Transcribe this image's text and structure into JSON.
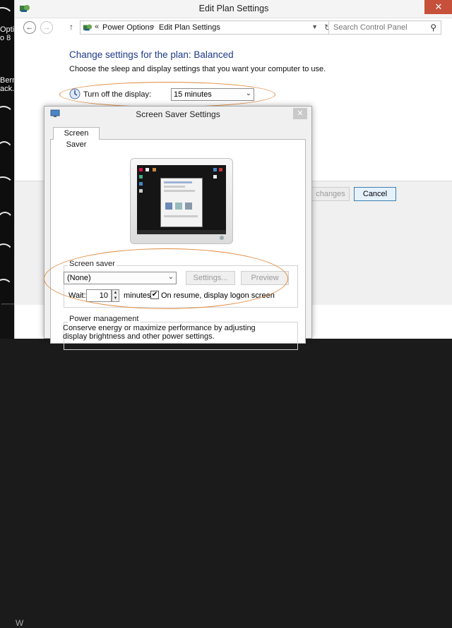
{
  "desktop": {
    "labels": [
      "Optic",
      "o 8",
      "Bern",
      "ack."
    ],
    "logo_text": "W"
  },
  "window": {
    "title": "Edit Plan Settings",
    "close_glyph": "✕"
  },
  "navigation": {
    "back_glyph": "←",
    "forward_glyph": "→",
    "up_glyph": "↑",
    "breadcrumb_sep": "«",
    "breadcrumbs": [
      "Power Options",
      "Edit Plan Settings"
    ],
    "crumb_arrow": "›",
    "search_placeholder": "Search Control Panel"
  },
  "plan": {
    "heading": "Change settings for the plan: Balanced",
    "subheading": "Choose the sleep and display settings that you want your computer to use.",
    "display_label": "Turn off the display:",
    "display_value": "15 minutes",
    "save_label": "changes",
    "cancel_label": "Cancel"
  },
  "dialog": {
    "title": "Screen Saver Settings",
    "close_glyph": "✕",
    "tab": "Screen Saver",
    "screen_saver_group": "Screen saver",
    "screen_saver_value": "(None)",
    "settings_button": "Settings...",
    "preview_button": "Preview",
    "wait_label": "Wait:",
    "wait_value": "10",
    "minutes_label": "minutes",
    "resume_label": "On resume, display logon screen",
    "resume_checked": "✔",
    "power_group": "Power management",
    "power_text": "Conserve energy or maximize performance by adjusting display brightness and other power settings."
  },
  "colors": {
    "accent": "#1e3a8a",
    "highlight": "#e08a3c",
    "close": "#c7503b"
  },
  "icons": [
    "control-panel-icon",
    "back-icon",
    "forward-icon",
    "up-icon",
    "refresh-icon",
    "search-icon",
    "display-icon",
    "dialog-icon",
    "chevron-down-icon"
  ]
}
